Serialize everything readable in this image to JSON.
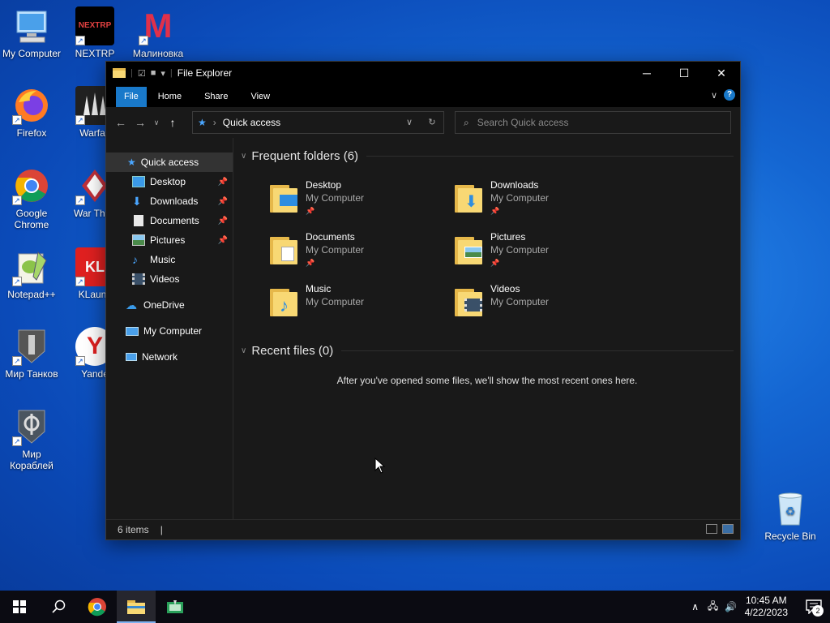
{
  "desktop": {
    "icons": [
      {
        "label": "My Computer"
      },
      {
        "label": "NEXTRP",
        "logo_text": "NEXTRP"
      },
      {
        "label": "Малиновка",
        "logo_text": "M"
      },
      {
        "label": "Firefox"
      },
      {
        "label": "Warfac"
      },
      {
        "label": "Google Chrome"
      },
      {
        "label": "War Thun"
      },
      {
        "label": "Notepad++"
      },
      {
        "label": "KLaunc",
        "logo_text": "KL"
      },
      {
        "label": "Мир Танков"
      },
      {
        "label": "Yande",
        "logo_text": "Y"
      },
      {
        "label": "Мир Кораблей"
      },
      {
        "label": "Recycle Bin"
      }
    ]
  },
  "window": {
    "title": "File Explorer",
    "ribbon_tabs": [
      "File",
      "Home",
      "Share",
      "View"
    ],
    "address": "Quick access",
    "search_placeholder": "Search Quick access",
    "nav": {
      "quick_access": "Quick access",
      "items": [
        {
          "label": "Desktop",
          "pinned": true
        },
        {
          "label": "Downloads",
          "pinned": true
        },
        {
          "label": "Documents",
          "pinned": true
        },
        {
          "label": "Pictures",
          "pinned": true
        },
        {
          "label": "Music",
          "pinned": false
        },
        {
          "label": "Videos",
          "pinned": false
        }
      ],
      "onedrive": "OneDrive",
      "my_computer": "My Computer",
      "network": "Network"
    },
    "frequent": {
      "header": "Frequent folders (6)",
      "folders": [
        {
          "name": "Desktop",
          "location": "My Computer",
          "pinned": true
        },
        {
          "name": "Downloads",
          "location": "My Computer",
          "pinned": true
        },
        {
          "name": "Documents",
          "location": "My Computer",
          "pinned": true
        },
        {
          "name": "Pictures",
          "location": "My Computer",
          "pinned": true
        },
        {
          "name": "Music",
          "location": "My Computer",
          "pinned": false
        },
        {
          "name": "Videos",
          "location": "My Computer",
          "pinned": false
        }
      ]
    },
    "recent": {
      "header": "Recent files (0)",
      "empty_message": "After you've opened some files, we'll show the most recent ones here."
    },
    "status": "6 items"
  },
  "taskbar": {
    "time": "10:45 AM",
    "date": "4/22/2023",
    "notification_count": "2"
  },
  "colors": {
    "accent": "#1979ca",
    "folder": "#f8d874"
  }
}
